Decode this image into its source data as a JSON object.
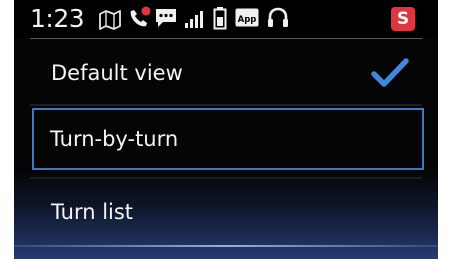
{
  "status_bar": {
    "time": "1:23",
    "icons": [
      "map-icon",
      "phone-missed-call-icon",
      "message-icon",
      "signal-strength-icon",
      "battery-icon",
      "app-icon",
      "headset-icon"
    ],
    "app_icon_label": "App",
    "badge_label": "S",
    "badge_color": "#e2343f"
  },
  "menu": {
    "items": [
      {
        "label": "Default view",
        "selected": true
      },
      {
        "label": "Turn-by-turn",
        "focused": true
      },
      {
        "label": "Turn list"
      }
    ]
  },
  "colors": {
    "background": "#050505",
    "text": "#f4f4f4",
    "accent": "#3c79c9",
    "checkmark": "#3f88e0"
  }
}
